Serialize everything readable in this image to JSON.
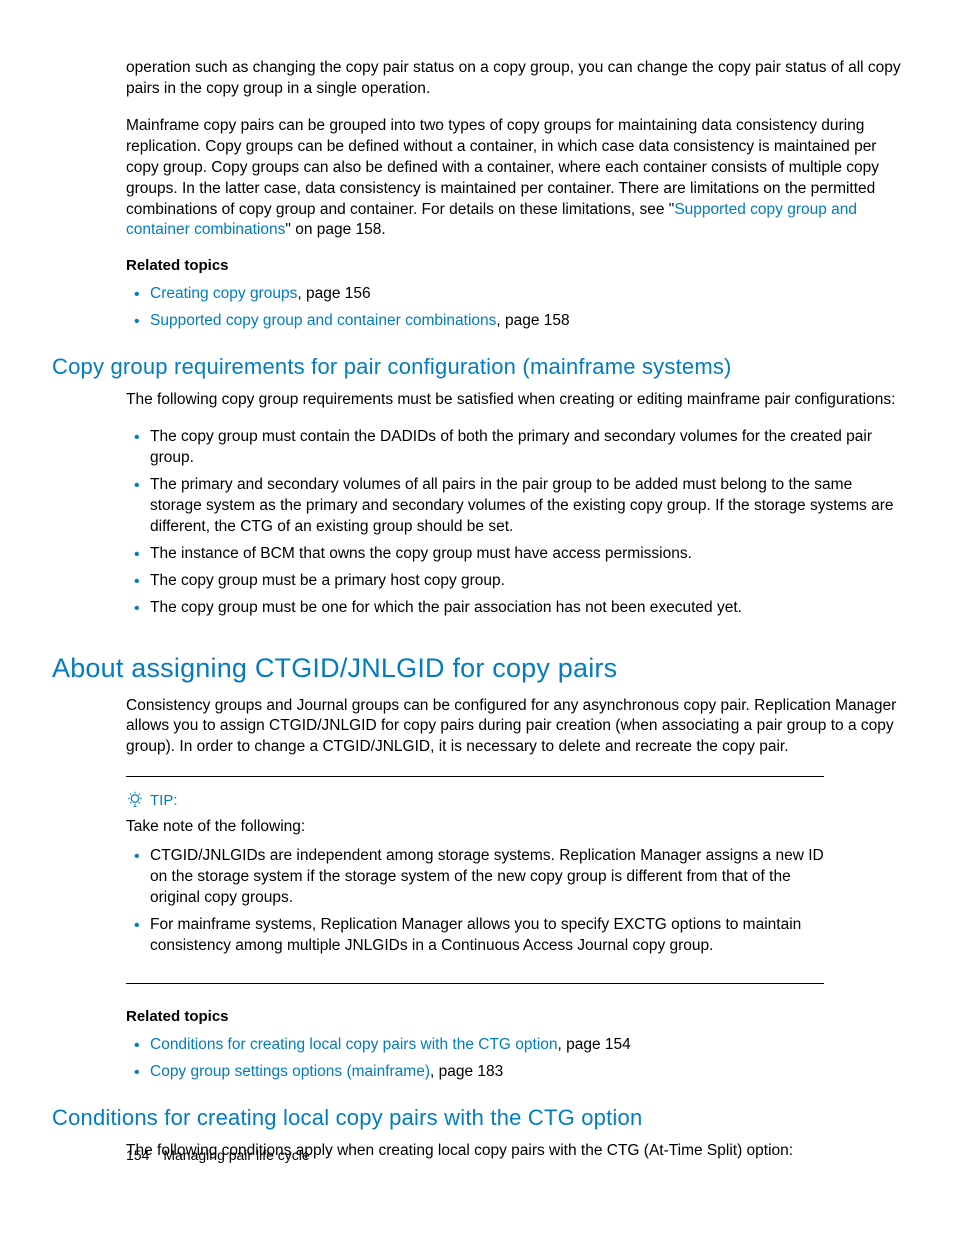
{
  "intro": {
    "p1": "operation such as changing the copy pair status on a copy group, you can change  the copy pair status of all copy pairs in the copy group in a single operation.",
    "p2_a": "Mainframe copy pairs can be grouped into two types of copy groups for maintaining data consistency during replication. Copy groups can be defined without a container, in which case data consistency is maintained per copy group. Copy groups can also be defined with a container, where each container consists of multiple copy groups. In the latter case, data consistency is maintained per container. There are limitations on the permitted combinations of copy group and container. For details on these limitations, see \"",
    "p2_link": "Supported copy group and container combinations",
    "p2_b": "\" on page 158."
  },
  "related1": {
    "heading": "Related topics",
    "items": [
      {
        "link": "Creating copy groups",
        "suffix": ", page 156"
      },
      {
        "link": "Supported copy group and container combinations",
        "suffix": ", page 158"
      }
    ]
  },
  "section1": {
    "heading": "Copy group requirements for pair configuration (mainframe systems)",
    "intro": "The following copy group requirements must be satisfied when creating or editing mainframe pair configurations:",
    "bullets": [
      "The copy group must contain the DADIDs of both the primary and secondary volumes for the created pair group.",
      "The primary and secondary volumes of all pairs in the pair group to be added must belong to the same storage system as the primary and secondary volumes of the existing copy group. If the storage systems are different, the CTG of an existing group should be set.",
      "The instance of BCM that owns the copy group must have access permissions.",
      "The copy group must be a primary host copy group.",
      "The copy group must be one for which the pair association has not been executed yet."
    ]
  },
  "section2": {
    "heading": "About assigning CTGID/JNLGID for copy pairs",
    "intro": "Consistency groups and Journal groups can be configured for any asynchronous copy pair. Replication Manager allows you to assign CTGID/JNLGID for copy pairs during pair creation (when associating a pair group to a copy group).  In order to change a CTGID/JNLGID, it is necessary to delete and recreate the copy pair."
  },
  "tip": {
    "label": "TIP:",
    "intro": "Take note of the following:",
    "bullets": [
      "CTGID/JNLGIDs are independent among storage systems. Replication Manager assigns a new ID on the storage system if the storage system of the new copy group is different from that of the original copy groups.",
      "For mainframe systems, Replication Manager allows you to specify EXCTG options to maintain consistency among multiple JNLGIDs in a Continuous Access Journal copy group."
    ]
  },
  "related2": {
    "heading": "Related topics",
    "items": [
      {
        "link": "Conditions for creating local copy pairs with the CTG option",
        "suffix": ", page 154"
      },
      {
        "link": "Copy group settings options (mainframe)",
        "suffix": ", page 183"
      }
    ]
  },
  "section3": {
    "heading": "Conditions for creating local copy pairs with the CTG option",
    "intro": "The following conditions apply when creating local copy pairs with the CTG (At-Time Split) option:"
  },
  "footer": {
    "page_number": "154",
    "chapter": "Managing pair life cycle"
  }
}
